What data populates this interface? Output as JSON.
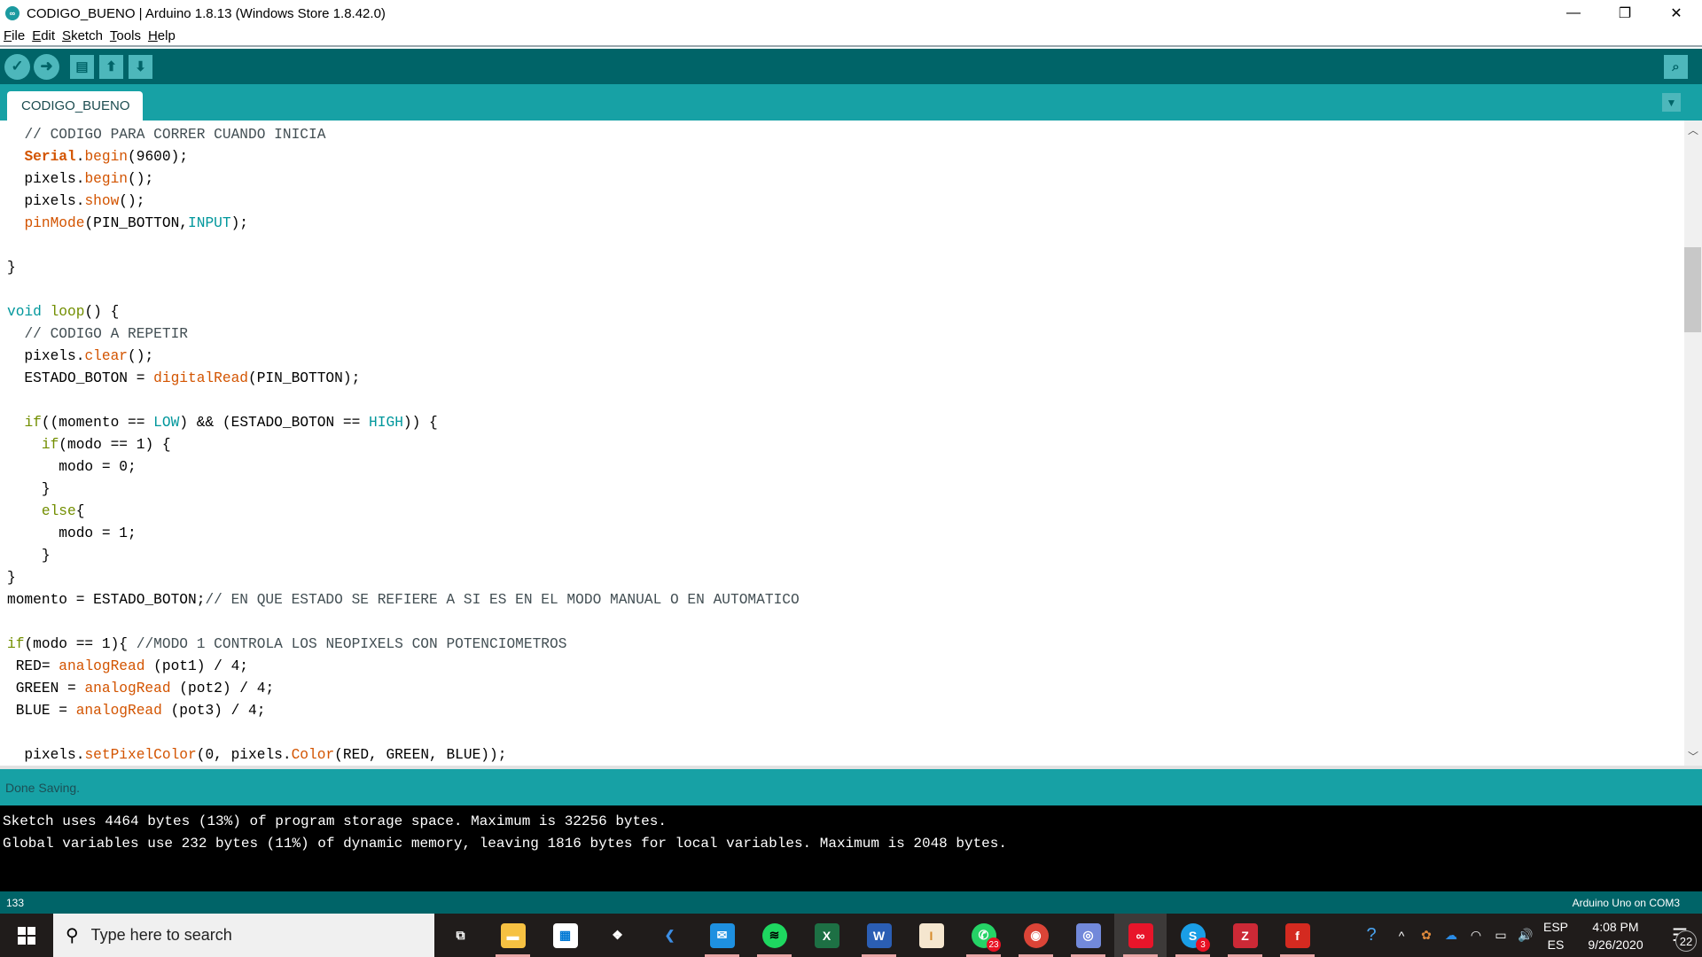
{
  "window": {
    "title": "CODIGO_BUENO | Arduino 1.8.13 (Windows Store 1.8.42.0)",
    "app_icon": "arduino-infinity-icon",
    "controls": {
      "minimize": "—",
      "maximize": "❐",
      "close": "✕"
    }
  },
  "menu": [
    {
      "key": "F",
      "rest": "ile"
    },
    {
      "key": "E",
      "rest": "dit"
    },
    {
      "key": "S",
      "rest": "ketch"
    },
    {
      "key": "T",
      "rest": "ools"
    },
    {
      "key": "H",
      "rest": "elp"
    }
  ],
  "toolbar": {
    "verify": {
      "glyph": "✓",
      "icon": "checkmark-icon"
    },
    "upload": {
      "glyph": "➜",
      "icon": "arrow-right-icon"
    },
    "new": {
      "glyph": "▤",
      "icon": "new-file-icon"
    },
    "open": {
      "glyph": "⬆",
      "icon": "open-arrow-up-icon"
    },
    "save": {
      "glyph": "⬇",
      "icon": "save-arrow-down-icon"
    },
    "serial_monitor": {
      "glyph": "⌕",
      "icon": "serial-monitor-icon"
    }
  },
  "tabs": [
    {
      "label": "CODIGO_BUENO",
      "active": true
    }
  ],
  "tab_menu_glyph": "▼",
  "editor": {
    "lines": [
      [
        {
          "t": "  "
        },
        {
          "t": "// CODIGO PARA CORRER CUANDO INICIA",
          "c": "c-comment"
        }
      ],
      [
        {
          "t": "  "
        },
        {
          "t": "Serial",
          "c": "c-cls"
        },
        {
          "t": "."
        },
        {
          "t": "begin",
          "c": "c-fn"
        },
        {
          "t": "(9600);"
        }
      ],
      [
        {
          "t": "  pixels."
        },
        {
          "t": "begin",
          "c": "c-fn"
        },
        {
          "t": "();"
        }
      ],
      [
        {
          "t": "  pixels."
        },
        {
          "t": "show",
          "c": "c-fn"
        },
        {
          "t": "();"
        }
      ],
      [
        {
          "t": "  "
        },
        {
          "t": "pinMode",
          "c": "c-fn"
        },
        {
          "t": "(PIN_BOTTON,"
        },
        {
          "t": "INPUT",
          "c": "c-const"
        },
        {
          "t": ");"
        }
      ],
      [
        {
          "t": ""
        }
      ],
      [
        {
          "t": "}"
        }
      ],
      [
        {
          "t": ""
        }
      ],
      [
        {
          "t": "void",
          "c": "c-kw"
        },
        {
          "t": " "
        },
        {
          "t": "loop",
          "c": "c-ctrl"
        },
        {
          "t": "() {"
        }
      ],
      [
        {
          "t": "  "
        },
        {
          "t": "// CODIGO A REPETIR",
          "c": "c-comment"
        }
      ],
      [
        {
          "t": "  pixels."
        },
        {
          "t": "clear",
          "c": "c-fn"
        },
        {
          "t": "();"
        }
      ],
      [
        {
          "t": "  ESTADO_BOTON = "
        },
        {
          "t": "digitalRead",
          "c": "c-fn"
        },
        {
          "t": "(PIN_BOTTON);"
        }
      ],
      [
        {
          "t": ""
        }
      ],
      [
        {
          "t": "  "
        },
        {
          "t": "if",
          "c": "c-ctrl"
        },
        {
          "t": "((momento == "
        },
        {
          "t": "LOW",
          "c": "c-const"
        },
        {
          "t": ") && (ESTADO_BOTON == "
        },
        {
          "t": "HIGH",
          "c": "c-const"
        },
        {
          "t": ")) {"
        }
      ],
      [
        {
          "t": "    "
        },
        {
          "t": "if",
          "c": "c-ctrl"
        },
        {
          "t": "(modo == 1) {"
        }
      ],
      [
        {
          "t": "      modo = 0;"
        }
      ],
      [
        {
          "t": "    }"
        }
      ],
      [
        {
          "t": "    "
        },
        {
          "t": "else",
          "c": "c-ctrl"
        },
        {
          "t": "{"
        }
      ],
      [
        {
          "t": "      modo = 1;"
        }
      ],
      [
        {
          "t": "    }"
        }
      ],
      [
        {
          "t": "}"
        }
      ],
      [
        {
          "t": "momento = ESTADO_BOTON;"
        },
        {
          "t": "// EN QUE ESTADO SE REFIERE A SI ES EN EL MODO MANUAL O EN AUTOMATICO",
          "c": "c-comment"
        }
      ],
      [
        {
          "t": ""
        }
      ],
      [
        {
          "t": "if",
          "c": "c-ctrl"
        },
        {
          "t": "(modo == 1){ "
        },
        {
          "t": "//MODO 1 CONTROLA LOS NEOPIXELS CON POTENCIOMETROS",
          "c": "c-comment"
        }
      ],
      [
        {
          "t": " RED= "
        },
        {
          "t": "analogRead",
          "c": "c-fn"
        },
        {
          "t": " (pot1) / 4;"
        }
      ],
      [
        {
          "t": " GREEN = "
        },
        {
          "t": "analogRead",
          "c": "c-fn"
        },
        {
          "t": " (pot2) / 4;"
        }
      ],
      [
        {
          "t": " BLUE = "
        },
        {
          "t": "analogRead",
          "c": "c-fn"
        },
        {
          "t": " (pot3) / 4;"
        }
      ],
      [
        {
          "t": ""
        }
      ],
      [
        {
          "t": "  pixels."
        },
        {
          "t": "setPixelColor",
          "c": "c-fn"
        },
        {
          "t": "(0, pixels."
        },
        {
          "t": "Color",
          "c": "c-fn"
        },
        {
          "t": "(RED, GREEN, BLUE));"
        }
      ]
    ],
    "scroll": {
      "up_glyph": "︿",
      "down_glyph": "﹀"
    }
  },
  "status": {
    "message": "Done Saving."
  },
  "console": {
    "lines": [
      "Sketch uses 4464 bytes (13%) of program storage space. Maximum is 32256 bytes.",
      "Global variables use 232 bytes (11%) of dynamic memory, leaving 1816 bytes for local variables. Maximum is 2048 bytes."
    ]
  },
  "footer": {
    "line_number": "133",
    "board": "Arduino Uno on COM3"
  },
  "taskbar": {
    "search_placeholder": "Type here to search",
    "search_glyph": "⚲",
    "apps": [
      {
        "name": "task-view",
        "glyph": "⧉",
        "bg": "transparent",
        "underline": false,
        "active": false
      },
      {
        "name": "file-explorer",
        "glyph": "▬",
        "bg": "#f6c142",
        "underline": true,
        "active": false
      },
      {
        "name": "microsoft-store",
        "glyph": "▦",
        "bg": "#ffffff",
        "underline": false,
        "active": false,
        "fg": "#0078d4"
      },
      {
        "name": "dropbox",
        "glyph": "❖",
        "bg": "transparent",
        "underline": false,
        "active": false
      },
      {
        "name": "visual-studio",
        "glyph": "❮",
        "bg": "transparent",
        "underline": false,
        "active": false,
        "fg": "#3c8ee5"
      },
      {
        "name": "mail",
        "glyph": "✉",
        "bg": "#1e90e0",
        "underline": true,
        "active": false
      },
      {
        "name": "spotify",
        "glyph": "≋",
        "bg": "#1ed760",
        "underline": true,
        "active": false,
        "round": true,
        "fg": "#000"
      },
      {
        "name": "excel",
        "glyph": "X",
        "bg": "#1d7044",
        "underline": false,
        "active": false
      },
      {
        "name": "word",
        "glyph": "W",
        "bg": "#2b5eb4",
        "underline": true,
        "active": false
      },
      {
        "name": "inventor",
        "glyph": "I",
        "bg": "#f5e6cf",
        "underline": false,
        "active": false,
        "fg": "#d68a2a"
      },
      {
        "name": "whatsapp",
        "glyph": "✆",
        "bg": "#25d366",
        "underline": true,
        "active": false,
        "round": true,
        "badge": "23"
      },
      {
        "name": "chrome",
        "glyph": "◉",
        "bg": "#db4437",
        "underline": true,
        "active": false,
        "round": true
      },
      {
        "name": "discord",
        "glyph": "◎",
        "bg": "#7289da",
        "underline": true,
        "active": false
      },
      {
        "name": "arduino",
        "glyph": "∞",
        "bg": "#e8152a",
        "underline": true,
        "active": true
      },
      {
        "name": "skype",
        "glyph": "S",
        "bg": "#1a9ee6",
        "underline": true,
        "active": false,
        "round": true,
        "badge": "3"
      },
      {
        "name": "zotero",
        "glyph": "Z",
        "bg": "#cc2936",
        "underline": true,
        "active": false
      },
      {
        "name": "filezilla",
        "glyph": "f",
        "bg": "#d42a20",
        "underline": true,
        "active": false
      }
    ],
    "tray": [
      {
        "name": "help-icon",
        "glyph": "?"
      },
      {
        "name": "show-hidden-icons-chevron",
        "glyph": "^"
      },
      {
        "name": "tray-app-icon",
        "glyph": "✿"
      },
      {
        "name": "onedrive-icon",
        "glyph": "☁"
      },
      {
        "name": "wifi-icon",
        "glyph": "◠"
      },
      {
        "name": "battery-icon",
        "glyph": "▭"
      },
      {
        "name": "volume-icon",
        "glyph": "🔊"
      }
    ],
    "language": {
      "top": "ESP",
      "bottom": "ES"
    },
    "clock": {
      "time": "4:08 PM",
      "date": "9/26/2020"
    },
    "notification_count": "22",
    "notification_glyph": "☰"
  }
}
